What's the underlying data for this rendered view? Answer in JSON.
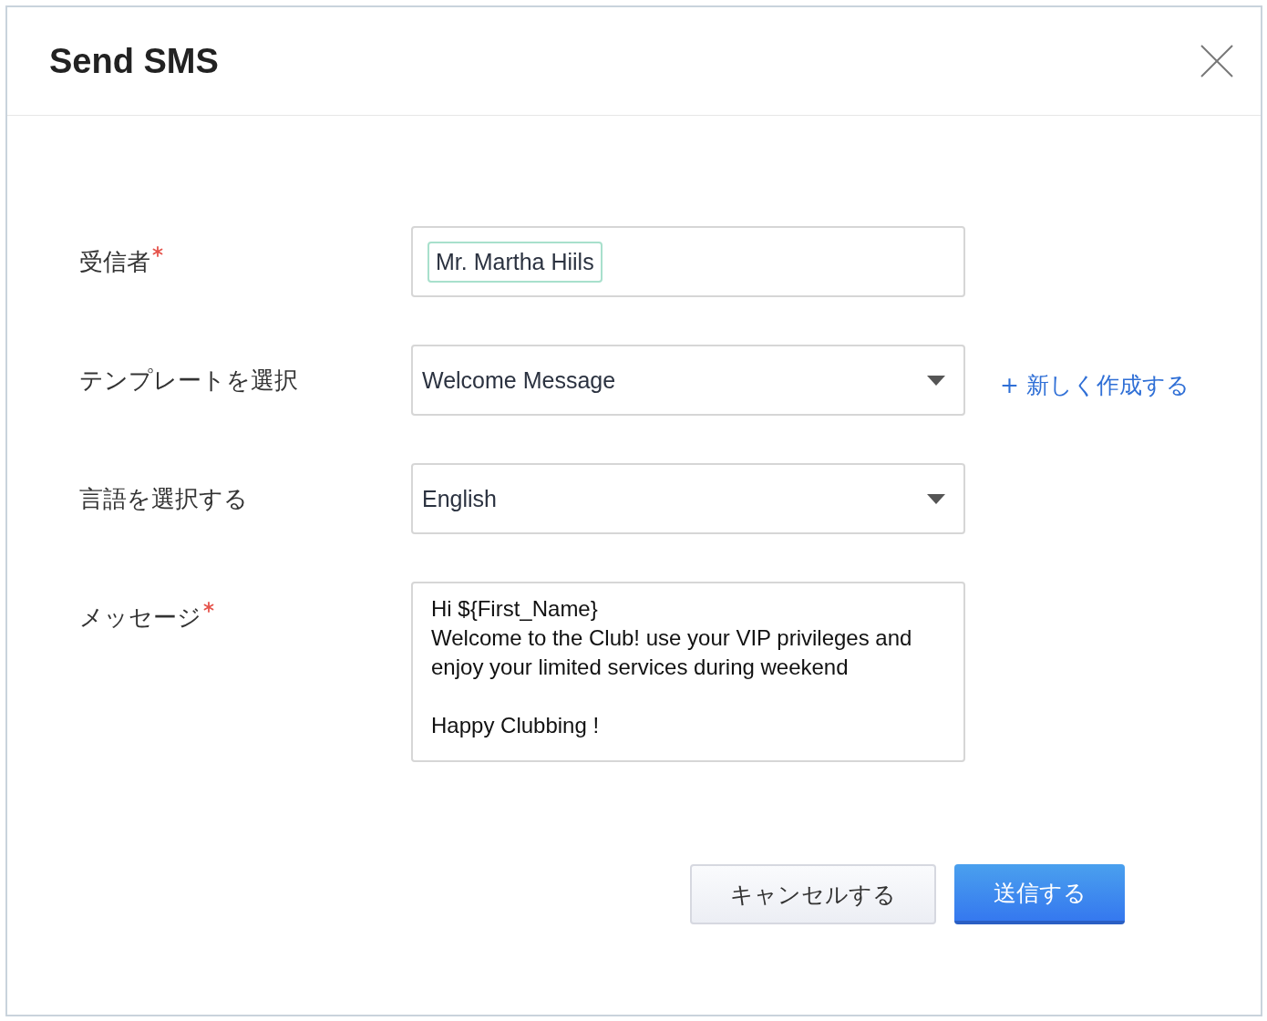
{
  "dialog": {
    "title": "Send SMS"
  },
  "fields": [
    {
      "kind": "recipient",
      "label": "受信者",
      "required": true,
      "value": "Mr. Martha Hiils"
    },
    {
      "kind": "select",
      "label": "テンプレートを選択",
      "required": false,
      "value": "Welcome Message",
      "link": "+ 新しく作成する"
    },
    {
      "kind": "select",
      "label": "言語を選択する",
      "required": false,
      "value": "English"
    },
    {
      "kind": "textarea",
      "label": "メッセージ",
      "required": true,
      "value": "Hi ${First_Name}\nWelcome to the Club! use your VIP privileges and\nenjoy your limited services during weekend\n\nHappy Clubbing !"
    }
  ],
  "buttons": [
    {
      "kind": "secondary",
      "label": "キャンセルする"
    },
    {
      "kind": "primary",
      "label": "送信する"
    }
  ]
}
